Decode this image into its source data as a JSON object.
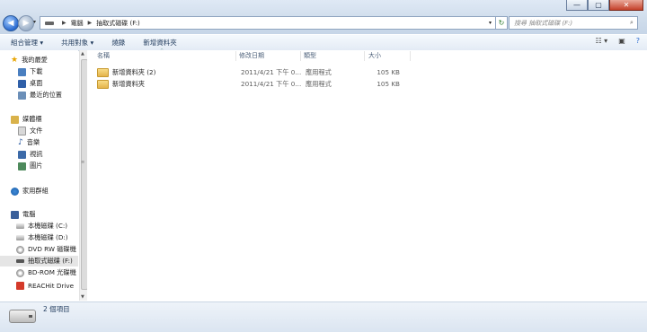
{
  "window": {
    "buttons": [
      "—",
      "▢",
      "✕"
    ]
  },
  "address": {
    "segments": [
      "電腦",
      "抽取式磁碟 (F:)"
    ]
  },
  "search": {
    "placeholder": "搜尋 抽取式磁碟 (F:)"
  },
  "toolbar": {
    "organize": "組合管理 ▾",
    "share": "共用對象 ▾",
    "burn": "燒錄",
    "new_folder": "新增資料夾"
  },
  "nav": {
    "favorites": "我的最愛",
    "downloads": "下載",
    "desktop": "桌面",
    "recent": "最近的位置",
    "libraries": "媒體櫃",
    "documents": "文件",
    "music": "音樂",
    "videos": "視訊",
    "pictures": "圖片",
    "homegroup": "家用群組",
    "computer": "電腦",
    "drive_c": "本機磁碟 (C:)",
    "drive_d": "本機磁碟 (D:)",
    "dvd": "DVD RW 磁碟機",
    "drive_f": "抽取式磁碟 (F:)",
    "bdrom": "BD-ROM 光碟機",
    "reachit": "REACHit Drive"
  },
  "columns": {
    "name": "名稱",
    "modified": "修改日期",
    "type": "類型",
    "size": "大小"
  },
  "files": [
    {
      "name": "新增資料夾 (2)",
      "modified": "2011/4/21 下午 0...",
      "type": "應用程式",
      "size": "105 KB"
    },
    {
      "name": "新增資料夾",
      "modified": "2011/4/21 下午 0...",
      "type": "應用程式",
      "size": "105 KB"
    }
  ],
  "status": {
    "item_count": "2 個項目"
  },
  "colors": {
    "chrome": "#cfdceb",
    "toolbar_text": "#1e395b",
    "folder": "#e4b34a"
  }
}
